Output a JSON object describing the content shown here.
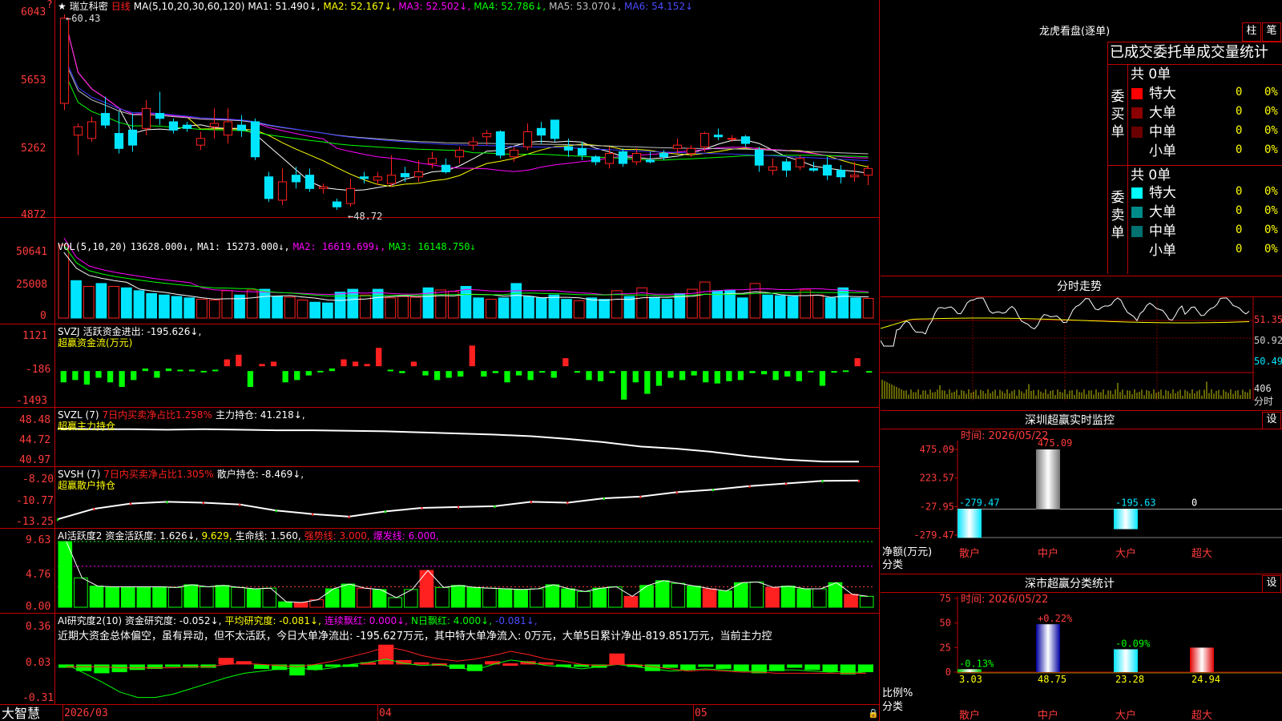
{
  "colors": {
    "up": "#ff2020",
    "down": "#00e5ff",
    "ma1": "#ffffff",
    "ma2": "#ffff00",
    "ma3": "#ff00ff",
    "ma4": "#00ff00",
    "ma5": "#c0c0c0",
    "ma6": "#3a3aff",
    "axis": "#ff3b3b",
    "grid": "#c00000"
  },
  "stock": {
    "name": "瑞立科密",
    "period": "日线",
    "star": "★",
    "q": "?"
  },
  "main": {
    "ma_label": "MA(5,10,20,30,60,120)",
    "ma1": "MA1: 51.490↓,",
    "ma2": "MA2: 52.167↓,",
    "ma3": "MA3: 52.502↓,",
    "ma4": "MA4: 52.786↓,",
    "ma5": "MA5: 53.070↓,",
    "ma6": "MA6: 54.152↓",
    "yticks": [
      "6043",
      "5653",
      "5262",
      "4872"
    ],
    "high_label": "←60.43",
    "low_label": "←48.72"
  },
  "vol": {
    "label": "VOL(5,10,20)",
    "v": "13628.000↓,",
    "ma1": "MA1: 15273.000↓,",
    "ma2": "MA2: 16619.699↓,",
    "ma3": "MA3: 16148.750↓",
    "yticks": [
      "50641",
      "25008",
      "0"
    ]
  },
  "svzj": {
    "label": "SVZJ",
    "desc": "活跃资金进出: -195.626↓,",
    "sub": "超赢资金流(万元)",
    "yticks": [
      "1121",
      "-186",
      "-1493"
    ]
  },
  "svzl": {
    "label": "SVZL (7)",
    "desc": "7日内买卖净占比1.258%",
    "v": "主力持仓: 41.218↓,",
    "sub": "超赢主力持仓",
    "yticks": [
      "48.48",
      "44.72",
      "40.97"
    ]
  },
  "svsh": {
    "label": "SVSH (7)",
    "desc": "7日内买卖净占比1.305%",
    "v": "散户持仓: -8.469↓,",
    "sub": "超赢散户持仓",
    "yticks": [
      "-8.20",
      "-10.77",
      "-13.25"
    ]
  },
  "ai1": {
    "label": "AI活跃度2",
    "v1": "资金活跃度: 1.626↓,",
    "v2": "9.629,",
    "v3": "生命线: 1.560,",
    "v4": "强势线: 3.000,",
    "v5": "爆发线: 6.000,",
    "yticks": [
      "9.63",
      "4.76",
      "0.00"
    ]
  },
  "ai2": {
    "label": "AI研究度2(10)",
    "v1": "资金研究度: -0.052↓,",
    "v2": "平均研究度: -0.081↓,",
    "v3": "连续飘红: 0.000↓,",
    "v4": "N日飘红: 4.000↓,",
    "v5": "-0.081↓,",
    "note": "近期大资金总体偏空，虽有异动，但不太活跃，今日大单净流出: -195.627万元，其中特大单净流入: 0万元，大单5日累计净出-819.851万元，当前主力控",
    "yticks": [
      "0.36",
      "0.03",
      "-0.31"
    ]
  },
  "xaxis": {
    "brand": "大智慧",
    "labels": [
      "2026/03",
      "04",
      "05"
    ]
  },
  "side": {
    "lhk_title": "龙虎看盘(逐单)",
    "btn1": "柱",
    "btn2": "笔",
    "table_title": "已成交委托单成交量统计",
    "buy_side": "委买单",
    "sell_side": "委卖单",
    "buy_total": "共 0单",
    "sell_total": "共 0单",
    "buy_rows": [
      {
        "name": "特大",
        "v": "0",
        "p": "0%",
        "color": "#ff0000"
      },
      {
        "name": "大单",
        "v": "0",
        "p": "0%",
        "color": "#8b0000"
      },
      {
        "name": "中单",
        "v": "0",
        "p": "0%",
        "color": "#6a0000"
      },
      {
        "name": "小单",
        "v": "0",
        "p": "0%",
        "color": "#000000"
      }
    ],
    "sell_rows": [
      {
        "name": "特大",
        "v": "0",
        "p": "0%",
        "color": "#00ffff"
      },
      {
        "name": "大单",
        "v": "0",
        "p": "0%",
        "color": "#008b8b"
      },
      {
        "name": "中单",
        "v": "0",
        "p": "0%",
        "color": "#007070"
      },
      {
        "name": "小单",
        "v": "0",
        "p": "0%",
        "color": "#000000"
      }
    ],
    "fs_title": "分时走势",
    "fs_yticks": [
      "51.35",
      "50.92",
      "50.49"
    ],
    "fs_vol": "406",
    "fs_unit": "分时",
    "sz_title": "深圳超赢实时监控",
    "sz_btn": "设",
    "sz_time": "时间: 2026/05/22",
    "sz_yticks": [
      "475.09",
      "223.57",
      "-27.95",
      "-279.47"
    ],
    "sz_bars": [
      {
        "cat": "散户",
        "v": -279.47,
        "label": "-279.47"
      },
      {
        "cat": "中户",
        "v": 475.09,
        "label": "475.09"
      },
      {
        "cat": "大户",
        "v": -195.63,
        "label": "-195.63"
      },
      {
        "cat": "超大",
        "v": 0,
        "label": "0"
      }
    ],
    "sz_ylabel": "净额(万元)",
    "sz_xlabel": "分类",
    "ss_title": "深市超赢分类统计",
    "ss_btn": "设",
    "ss_time": "时间: 2026/05/22",
    "ss_yticks": [
      "75",
      "50",
      "25",
      "0"
    ],
    "ss_bars": [
      {
        "cat": "散户",
        "v": 3.03,
        "label": "3.03",
        "chg": "-0.13%"
      },
      {
        "cat": "中户",
        "v": 48.75,
        "label": "48.75",
        "chg": "+0.22%"
      },
      {
        "cat": "大户",
        "v": 23.28,
        "label": "23.28",
        "chg": "-0.09%"
      },
      {
        "cat": "超大",
        "v": 24.94,
        "label": "24.94",
        "chg": ""
      }
    ],
    "ss_ylabel": "比例%",
    "ss_xlabel": "分类"
  },
  "chart_data": [
    {
      "type": "candlestick",
      "title": "瑞立科密 日线",
      "ylim": [
        48.72,
        60.43
      ],
      "candles": [
        [
          55.1,
          60.2,
          54.7,
          60.43
        ],
        [
          53.2,
          53.7,
          52.0,
          53.9
        ],
        [
          53.0,
          54.0,
          52.8,
          54.3
        ],
        [
          54.5,
          53.8,
          53.6,
          55.5
        ],
        [
          53.3,
          52.4,
          52.1,
          54.6
        ],
        [
          53.5,
          52.6,
          52.2,
          54.5
        ],
        [
          53.6,
          54.8,
          53.2,
          55.3
        ],
        [
          54.5,
          54.2,
          53.8,
          55.8
        ],
        [
          54.0,
          53.5,
          53.3,
          54.2
        ],
        [
          53.8,
          53.6,
          53.4,
          54.0
        ],
        [
          52.6,
          53.0,
          52.3,
          53.4
        ],
        [
          53.7,
          53.9,
          53.0,
          54.8
        ],
        [
          53.2,
          54.0,
          52.7,
          54.8
        ],
        [
          53.8,
          53.5,
          53.1,
          54.4
        ],
        [
          54.0,
          51.9,
          51.7,
          54.2
        ],
        [
          50.7,
          49.4,
          49.2,
          51.0
        ],
        [
          49.3,
          50.4,
          49.0,
          51.2
        ],
        [
          50.8,
          50.4,
          50.0,
          51.3
        ],
        [
          50.8,
          50.0,
          49.8,
          51.2
        ],
        [
          50.0,
          50.1,
          49.7,
          50.3
        ],
        [
          49.2,
          48.9,
          48.72,
          49.4
        ],
        [
          49.1,
          50.0,
          48.9,
          50.6
        ],
        [
          50.7,
          50.6,
          50.3,
          51.0
        ],
        [
          50.5,
          50.7,
          50.2,
          51.0
        ],
        [
          50.3,
          50.8,
          50.1,
          52.0
        ],
        [
          50.9,
          50.7,
          50.4,
          51.3
        ],
        [
          50.7,
          51.0,
          50.4,
          51.7
        ],
        [
          51.5,
          51.8,
          51.2,
          52.2
        ],
        [
          51.4,
          51.0,
          50.9,
          51.8
        ],
        [
          51.9,
          52.3,
          51.5,
          52.5
        ],
        [
          52.6,
          52.8,
          52.3,
          53.1
        ],
        [
          53.1,
          53.3,
          52.6,
          53.5
        ],
        [
          53.4,
          52.0,
          51.8,
          53.5
        ],
        [
          51.9,
          52.3,
          51.6,
          52.5
        ],
        [
          52.5,
          53.4,
          52.3,
          53.9
        ],
        [
          53.6,
          53.2,
          52.7,
          54.0
        ],
        [
          54.1,
          53.0,
          52.8,
          54.0
        ],
        [
          52.5,
          52.3,
          51.9,
          53.0
        ],
        [
          52.4,
          52.0,
          51.7,
          52.8
        ],
        [
          51.9,
          51.6,
          51.4,
          52.0
        ],
        [
          51.5,
          52.1,
          51.2,
          52.5
        ],
        [
          52.2,
          51.5,
          51.3,
          52.4
        ],
        [
          51.6,
          52.1,
          51.4,
          52.4
        ],
        [
          51.7,
          51.6,
          51.5,
          52.2
        ],
        [
          52.1,
          51.9,
          51.7,
          52.3
        ],
        [
          52.4,
          52.6,
          52.1,
          53.0
        ],
        [
          52.1,
          52.4,
          51.9,
          52.6
        ],
        [
          52.5,
          53.3,
          52.2,
          53.4
        ],
        [
          53.2,
          53.1,
          52.9,
          53.6
        ],
        [
          53.0,
          53.0,
          52.8,
          53.2
        ],
        [
          53.1,
          52.7,
          52.5,
          53.2
        ],
        [
          52.3,
          51.4,
          51.0,
          52.5
        ],
        [
          51.1,
          51.3,
          50.8,
          51.8
        ],
        [
          51.6,
          51.1,
          50.7,
          51.8
        ],
        [
          51.3,
          51.8,
          51.1,
          52.0
        ],
        [
          51.2,
          51.1,
          51.0,
          51.6
        ],
        [
          51.4,
          50.8,
          50.5,
          51.9
        ],
        [
          51.1,
          50.7,
          50.3,
          51.4
        ],
        [
          50.7,
          50.8,
          50.4,
          51.6
        ],
        [
          50.8,
          51.2,
          50.2,
          51.4
        ]
      ]
    },
    {
      "type": "bar",
      "title": "VOL",
      "ylim": [
        0,
        50641
      ],
      "values": [
        50641,
        26000,
        22000,
        24000,
        22000,
        21000,
        19000,
        17000,
        16000,
        15000,
        14000,
        13000,
        12500,
        19000,
        16000,
        19500,
        20000,
        15000,
        14500,
        12500,
        11000,
        10500,
        18000,
        20000,
        16000,
        20000,
        14000,
        15000,
        14500,
        21000,
        19500,
        18500,
        22000,
        14000,
        13000,
        14000,
        24000,
        15000,
        14000,
        16000,
        13000,
        12000,
        14000,
        13000,
        19000,
        15000,
        21000,
        14500,
        13000,
        17000,
        20000,
        25000,
        19000,
        19500,
        14000,
        24000,
        16000,
        15500,
        15000,
        19500,
        16000,
        14000,
        21000,
        14000,
        13628
      ],
      "up": [
        true,
        false,
        true,
        false,
        true,
        false,
        false,
        false,
        false,
        false,
        false,
        true,
        true,
        true,
        false,
        true,
        false,
        false,
        true,
        true,
        false,
        false,
        false,
        false,
        true,
        false,
        true,
        true,
        true,
        false,
        true,
        true,
        false,
        false,
        true,
        false,
        false,
        false,
        false,
        false,
        false,
        true,
        false,
        false,
        true,
        false,
        true,
        false,
        false,
        false,
        true,
        true,
        false,
        false,
        false,
        true,
        false,
        false,
        false,
        true,
        true,
        false,
        false,
        false,
        true
      ]
    },
    {
      "type": "bar",
      "title": "SVZJ 超赢资金流(万元)",
      "ylim": [
        -1493,
        1121
      ],
      "values": [
        -700,
        -600,
        -800,
        -500,
        -700,
        -900,
        -600,
        -100,
        -500,
        -100,
        -150,
        -150,
        -200,
        -150,
        300,
        500,
        -900,
        100,
        200,
        -700,
        -600,
        -400,
        -200,
        -100,
        300,
        200,
        100,
        800,
        -150,
        -300,
        200,
        -400,
        -600,
        -500,
        -450,
        900,
        -450,
        -300,
        -700,
        -400,
        -600,
        -250,
        -500,
        350,
        -250,
        -600,
        -650,
        -300,
        -1450,
        -700,
        -1200,
        -850,
        -500,
        -600,
        -400,
        -700,
        -750,
        -650,
        -600,
        -300,
        -350,
        -600,
        -450,
        -650,
        -200,
        -850,
        -280,
        -180,
        350,
        -250
      ],
      "neg_mark": true
    },
    {
      "type": "line",
      "title": "SVZL 超赢主力持仓",
      "ylim": [
        40.97,
        48.48
      ],
      "values": [
        47.3,
        47.2,
        47.2,
        47.1,
        47.2,
        47.1,
        47.0,
        47.0,
        46.9,
        46.8,
        46.6,
        46.4,
        46.2,
        45.9,
        45.4,
        44.8,
        44.0,
        43.6,
        43.0,
        42.2,
        41.6,
        41.25,
        41.22
      ]
    },
    {
      "type": "line",
      "title": "SVSH 超赢散户持仓",
      "ylim": [
        -13.25,
        -8.2
      ],
      "values": [
        -12.9,
        -11.7,
        -11.1,
        -10.9,
        -11.0,
        -11.2,
        -11.9,
        -12.3,
        -12.6,
        -12.0,
        -11.6,
        -11.5,
        -11.4,
        -10.9,
        -11.0,
        -10.5,
        -10.3,
        -9.8,
        -9.5,
        -9.1,
        -8.8,
        -8.5,
        -8.47
      ]
    },
    {
      "type": "bar",
      "title": "AI活跃度2",
      "ylim": [
        0,
        9.63
      ],
      "values": [
        9.63,
        4.3,
        3.1,
        3.0,
        3.0,
        3.0,
        3.0,
        2.9,
        3.3,
        3.0,
        3.2,
        2.9,
        2.7,
        2.8,
        0.8,
        0.7,
        1.1,
        2.7,
        3.4,
        2.8,
        2.6,
        1.4,
        2.6,
        5.4,
        2.9,
        3.2,
        2.9,
        2.8,
        2.7,
        2.6,
        2.7,
        3.3,
        2.7,
        2.3,
        2.8,
        3.0,
        1.6,
        3.2,
        3.9,
        3.5,
        3.1,
        2.7,
        2.4,
        3.6,
        3.7,
        2.9,
        3.1,
        2.7,
        2.7,
        3.6,
        1.9,
        1.6
      ],
      "hollow_idx": [
        1,
        7,
        9,
        11,
        13,
        16,
        19,
        21,
        22,
        24,
        27,
        30,
        33,
        35,
        39,
        44,
        48,
        51
      ]
    },
    {
      "type": "bar",
      "title": "AI研究度2(10)",
      "ylim": [
        -0.31,
        0.36
      ],
      "values": [
        -0.03,
        -0.06,
        -0.08,
        -0.07,
        -0.05,
        -0.04,
        -0.02,
        -0.03,
        -0.03,
        0.06,
        0.03,
        -0.04,
        -0.05,
        -0.1,
        -0.05,
        -0.02,
        -0.01,
        0.02,
        0.18,
        0.04,
        0.02,
        0.01,
        -0.04,
        -0.06,
        0.03,
        0.01,
        0.03,
        0.02,
        -0.02,
        -0.01,
        -0.03,
        0.1,
        -0.02,
        -0.06,
        -0.03,
        -0.05,
        -0.02,
        -0.04,
        -0.06,
        -0.08,
        -0.06,
        -0.03,
        -0.05,
        -0.07,
        -0.09,
        -0.07
      ]
    }
  ]
}
